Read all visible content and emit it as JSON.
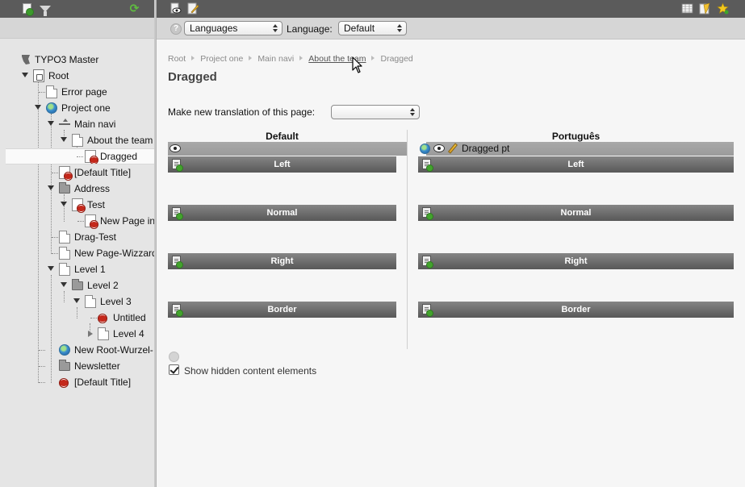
{
  "left_toolbar": {
    "new_page_icon": "page-add-icon",
    "filter_icon": "filter-icon",
    "refresh_icon": "refresh-icon"
  },
  "tree": {
    "site_root": "TYPO3 Master",
    "items": [
      {
        "label": "Root"
      },
      {
        "label": "Error page"
      },
      {
        "label": "Project one"
      },
      {
        "label": "Main navi"
      },
      {
        "label": "About the team"
      },
      {
        "label": "Dragged"
      },
      {
        "label": "[Default Title]"
      },
      {
        "label": "Address"
      },
      {
        "label": "Test"
      },
      {
        "label": "New Page in"
      },
      {
        "label": "Drag-Test"
      },
      {
        "label": "New Page-Wizzard"
      },
      {
        "label": "Level 1"
      },
      {
        "label": "Level 2"
      },
      {
        "label": "Level 3"
      },
      {
        "label": "Untitled"
      },
      {
        "label": "Level 4"
      },
      {
        "label": "New Root-Wurzel-"
      },
      {
        "label": "Newsletter"
      },
      {
        "label": "[Default Title]"
      }
    ]
  },
  "toolbar": {
    "view_icon": "view-page-icon",
    "edit_icon": "edit-page-icon",
    "right_icons": [
      "grid-icon",
      "clear-cache-icon",
      "bookmark-star-icon"
    ]
  },
  "subbar": {
    "function_select": "Languages",
    "language_label": "Language:",
    "language_select": "Default"
  },
  "breadcrumb": {
    "items": [
      "Root",
      "Project one",
      "Main navi",
      "About the team",
      "Dragged"
    ]
  },
  "page": {
    "title": "Dragged",
    "translation_label": "Make new translation of this page:",
    "translation_select": ""
  },
  "columns": {
    "default_header": "Default",
    "translation_header": "Português",
    "translation_page_title": "Dragged pt",
    "positions": [
      "Left",
      "Normal",
      "Right",
      "Border"
    ]
  },
  "footer": {
    "show_hidden_label": "Show hidden content elements",
    "show_hidden_checked": true
  },
  "colors": {
    "toolbar_bg": "#5b5b5b",
    "colpos_header_bg": "#6b6b6b",
    "tree_bg": "#e5e5e5"
  }
}
